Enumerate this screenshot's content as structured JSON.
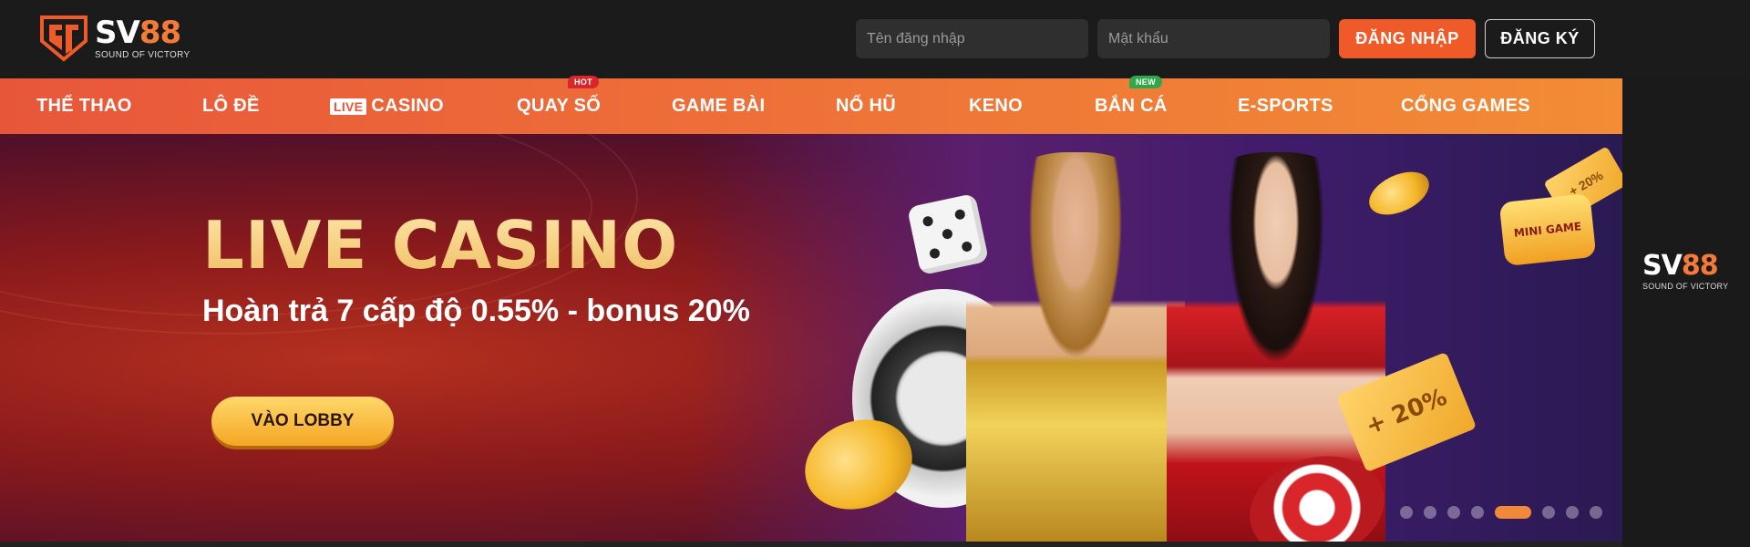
{
  "brand": {
    "name_part1": "SV",
    "name_part2": "88",
    "tagline": "SOUND OF VICTORY",
    "accent_color": "#f05a28"
  },
  "login": {
    "username_placeholder": "Tên đăng nhập",
    "password_placeholder": "Mật khẩu",
    "login_label": "ĐĂNG NHẬP",
    "register_label": "ĐĂNG KÝ"
  },
  "nav": {
    "items": [
      {
        "label": "THỂ THAO"
      },
      {
        "label": "LÔ ĐỀ"
      },
      {
        "prefix": "LIVE",
        "label": "CASINO"
      },
      {
        "label": "QUAY SỐ",
        "badge": "HOT"
      },
      {
        "label": "GAME BÀI"
      },
      {
        "label": "NỔ HŨ"
      },
      {
        "label": "KENO"
      },
      {
        "label": "BẮN CÁ",
        "badge": "NEW"
      },
      {
        "label": "E-SPORTS"
      },
      {
        "label": "CỔNG GAMES"
      }
    ]
  },
  "banner": {
    "title": "LIVE CASINO",
    "subtitle": "Hoàn trả 7 cấp độ 0.55% - bonus 20%",
    "cta_label": "VÀO LOBBY",
    "ticket_text": "+ 20%",
    "ticket_small_text": "+ 20%",
    "minigame_text": "MINI GAME",
    "slide_count": 8,
    "active_slide": 5
  }
}
